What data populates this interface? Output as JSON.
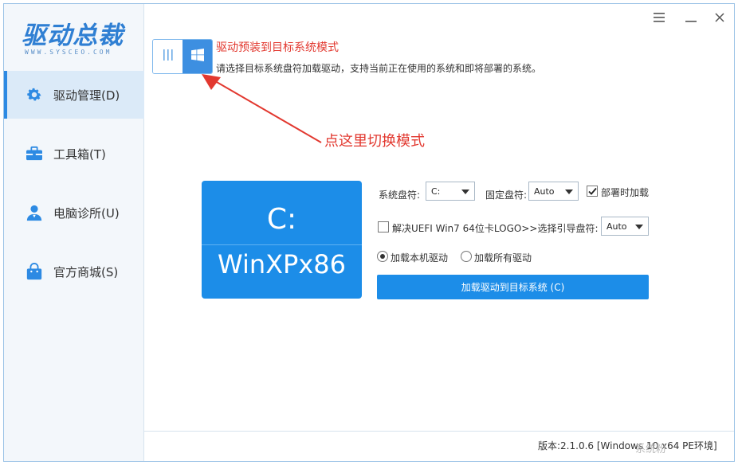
{
  "app": {
    "logo_text": "驱动总裁",
    "logo_sub": "WWW.SYSCEO.COM"
  },
  "sidebar": {
    "items": [
      {
        "label": "驱动管理(D)",
        "icon": "gear-icon",
        "active": true
      },
      {
        "label": "工具箱(T)",
        "icon": "toolbox-icon",
        "active": false
      },
      {
        "label": "电脑诊所(U)",
        "icon": "doctor-icon",
        "active": false
      },
      {
        "label": "官方商城(S)",
        "icon": "shopping-bag-icon",
        "active": false
      }
    ]
  },
  "titlebar": {
    "menu_icon": "menu-icon",
    "minimize_icon": "minimize-icon",
    "close_icon": "close-icon"
  },
  "mode": {
    "title": "驱动预装到目标系统模式",
    "description": "请选择目标系统盘符加载驱动，支持当前正在使用的系统和即将部署的系统。",
    "left_icon": "bars-icon",
    "right_icon": "windows-icon"
  },
  "annotation": {
    "hint": "点这里切换模式"
  },
  "card": {
    "drive": "C:",
    "os": "WinXPx86"
  },
  "options": {
    "system_drive_label": "系统盘符:",
    "system_drive_value": "C:",
    "fixed_drive_label": "固定盘符:",
    "fixed_drive_value": "Auto",
    "deploy_load_label": "部署时加载",
    "deploy_load_checked": true,
    "uefi_label": "解决UEFI Win7 64位卡LOGO>>选择引导盘符:",
    "uefi_checked": false,
    "boot_drive_value": "Auto",
    "radio_local_label": "加载本机驱动",
    "radio_all_label": "加载所有驱动",
    "radio_selected": "local",
    "load_button": "加载驱动到目标系统 (C)"
  },
  "footer": {
    "version": "版本:2.1.0.6 [Windows 10 x64 PE环境]",
    "watermark": "系统粉"
  },
  "colors": {
    "accent": "#1c8de8",
    "sidebar_bg": "#f3f7fb",
    "active_bg": "#dbeaf8",
    "red": "#e2382f"
  }
}
